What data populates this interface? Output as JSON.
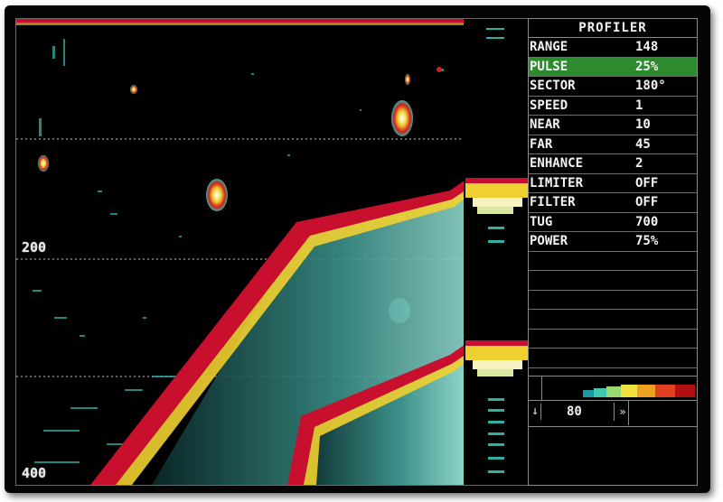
{
  "panel": {
    "title": "PROFILER",
    "settings": [
      {
        "label": "RANGE",
        "value": "148"
      },
      {
        "label": "PULSE",
        "value": "25%"
      },
      {
        "label": "SECTOR",
        "value": "180°"
      },
      {
        "label": "SPEED",
        "value": "1"
      },
      {
        "label": "NEAR",
        "value": "10"
      },
      {
        "label": "FAR",
        "value": "45"
      },
      {
        "label": "ENHANCE",
        "value": "2"
      },
      {
        "label": "LIMITER",
        "value": "OFF"
      },
      {
        "label": "FILTER",
        "value": "OFF"
      },
      {
        "label": "TUG",
        "value": "700"
      },
      {
        "label": "POWER",
        "value": "75%"
      }
    ],
    "selected_setting": "PULSE",
    "selected_color": "#2e8a2e"
  },
  "display": {
    "depth_labels": [
      "200",
      "400"
    ]
  },
  "gain": {
    "value": "80",
    "down_icon": "down-arrow-icon",
    "forward_icon": "fast-forward-icon",
    "colorbar_colors": [
      "#000000",
      "#1a9aa0",
      "#40c8b0",
      "#9ad870",
      "#f0e040",
      "#f0a020",
      "#e04020",
      "#b01010"
    ]
  },
  "colors": {
    "echo_strong": "#c8102e",
    "echo_mid": "#f5d020",
    "echo_weak": "#40d0c0",
    "background": "#000000"
  }
}
